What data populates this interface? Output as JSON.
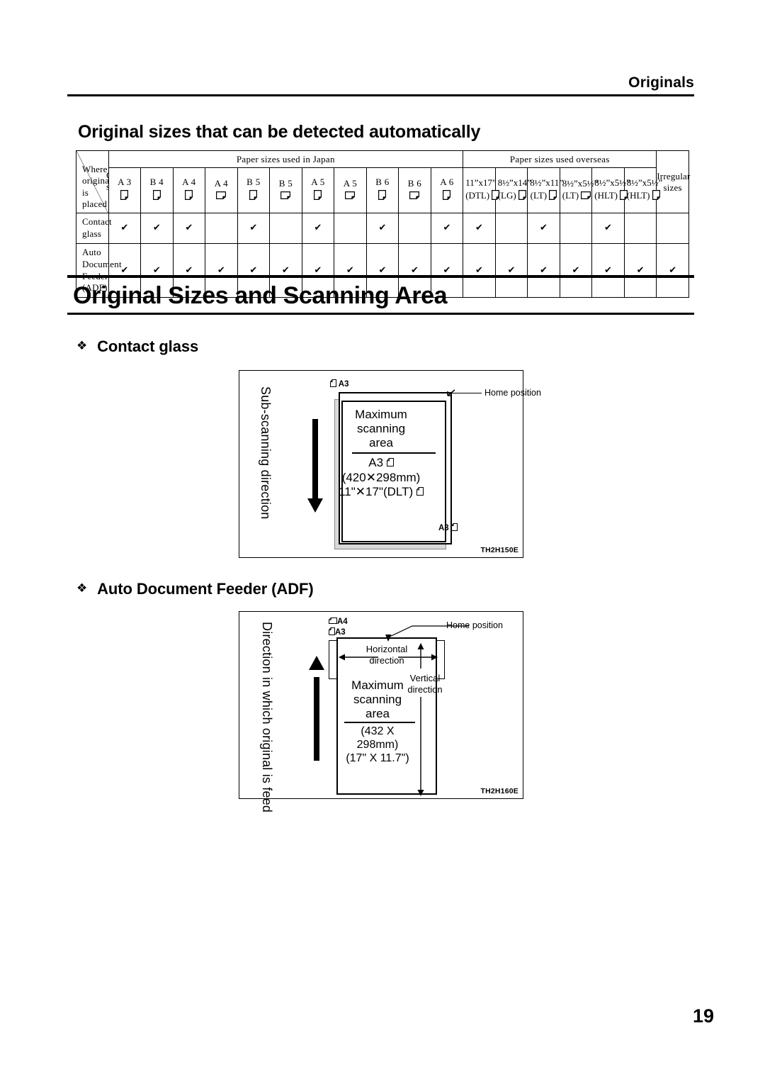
{
  "header": {
    "running_title": "Originals"
  },
  "subheading": "Original sizes that can be detected automatically",
  "table": {
    "corner_top_label": "Original size",
    "corner_bottom_label_line1": "Where original",
    "corner_bottom_label_line2": "is placed",
    "group_japan": "Paper sizes used in Japan",
    "group_overseas": "Paper sizes used overseas",
    "group_irregular": "Irregular sizes",
    "japan_columns": [
      {
        "label": "A 3",
        "orientation": "portrait"
      },
      {
        "label": "B 4",
        "orientation": "portrait"
      },
      {
        "label": "A 4",
        "orientation": "portrait"
      },
      {
        "label": "A 4",
        "orientation": "landscape"
      },
      {
        "label": "B 5",
        "orientation": "portrait"
      },
      {
        "label": "B 5",
        "orientation": "landscape"
      },
      {
        "label": "A 5",
        "orientation": "portrait"
      },
      {
        "label": "A 5",
        "orientation": "landscape"
      },
      {
        "label": "B 6",
        "orientation": "portrait"
      },
      {
        "label": "B 6",
        "orientation": "landscape"
      },
      {
        "label": "A 6",
        "orientation": "portrait"
      }
    ],
    "overseas_columns": [
      {
        "size": "11”x17”",
        "code": "(DTL)",
        "orientation": "portrait"
      },
      {
        "size": "8½”x14”",
        "code": "(LG)",
        "orientation": "portrait"
      },
      {
        "size": "8½”x11”",
        "code": "(LT)",
        "orientation": "portrait"
      },
      {
        "size": "8½”x5½”",
        "code": "(LT)",
        "orientation": "landscape"
      },
      {
        "size": "8½”x5½”",
        "code": "(HLT)",
        "orientation": "portrait"
      },
      {
        "size": "8½”x5½”",
        "code": "(HLT)",
        "orientation": "portrait"
      }
    ],
    "rows": [
      {
        "label_line1": "Contact glass",
        "label_line2": "",
        "japan": [
          true,
          true,
          true,
          false,
          true,
          false,
          true,
          false,
          true,
          false,
          true
        ],
        "overseas": [
          true,
          false,
          true,
          false,
          true,
          false
        ],
        "irregular": false
      },
      {
        "label_line1": "Auto Document",
        "label_line2": "Feeder (ADF)",
        "japan": [
          true,
          true,
          true,
          true,
          true,
          true,
          true,
          true,
          true,
          true,
          true
        ],
        "overseas": [
          true,
          true,
          true,
          true,
          true,
          true
        ],
        "irregular": true
      }
    ],
    "check_mark": "✔"
  },
  "section_title": "Original Sizes and Scanning Area",
  "sections": [
    {
      "bullet": "❖",
      "title": "Contact glass"
    },
    {
      "bullet": "❖",
      "title": "Auto Document Feeder (ADF)"
    }
  ],
  "figure_contact": {
    "direction_label": "Sub-scanning direction",
    "top_size_label": "A3",
    "bottom_size_label": "A3",
    "home_position": "Home position",
    "title_line1": "Maximum",
    "title_line2": "scanning",
    "title_line3": "area",
    "detail_line1": "A3",
    "detail_line2": "(420✕298mm)",
    "detail_line3": "11\"✕17\"(DLT)",
    "code": "TH2H150E"
  },
  "figure_adf": {
    "direction_label": "Direction in which original is feed",
    "size_label_a4": "A4",
    "size_label_a3": "A3",
    "home_position": "Home position",
    "horizontal_line1": "Horizontal",
    "horizontal_line2": "direction",
    "vertical_line1": "Vertical",
    "vertical_line2": "direction",
    "title_line1": "Maximum",
    "title_line2": "scanning",
    "title_line3": "area",
    "detail_line1": "(432 X 298mm)",
    "detail_line2": "(17\" X 11.7\")",
    "code": "TH2H160E"
  },
  "page_number": "19"
}
